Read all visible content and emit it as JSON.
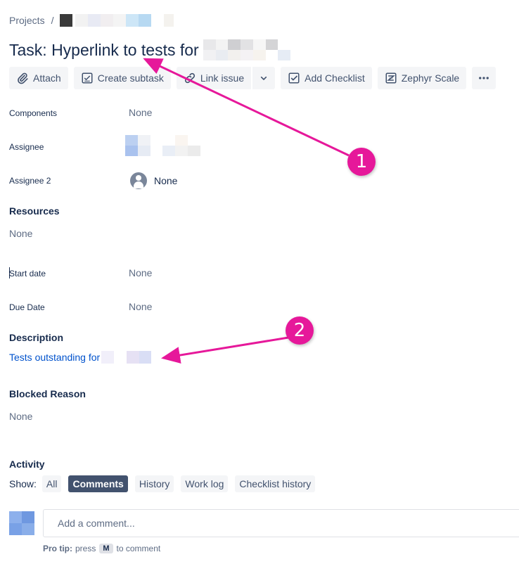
{
  "breadcrumb": {
    "projects": "Projects",
    "separator": "/"
  },
  "issue": {
    "title": "Task: Hyperlink to tests for"
  },
  "toolbar": {
    "attach": "Attach",
    "create_subtask": "Create subtask",
    "link_issue": "Link issue",
    "add_checklist": "Add Checklist",
    "zephyr_scale": "Zephyr Scale"
  },
  "fields": {
    "components": {
      "label": "Components",
      "value": "None"
    },
    "assignee": {
      "label": "Assignee"
    },
    "assignee2": {
      "label": "Assignee 2",
      "value": "None"
    },
    "resources": {
      "label": "Resources",
      "value": "None"
    },
    "start_date": {
      "label": "Start date",
      "value": "None"
    },
    "due_date": {
      "label": "Due Date",
      "value": "None"
    }
  },
  "description": {
    "heading": "Description",
    "link_text": "Tests outstanding for"
  },
  "blocked": {
    "heading": "Blocked Reason",
    "value": "None"
  },
  "activity": {
    "heading": "Activity",
    "show_label": "Show:",
    "filters": [
      "All",
      "Comments",
      "History",
      "Work log",
      "Checklist history"
    ],
    "active_filter": "Comments"
  },
  "comment": {
    "placeholder": "Add a comment...",
    "protip_bold": "Pro tip:",
    "protip_pre": "press",
    "protip_key": "M",
    "protip_post": "to comment"
  },
  "annotations": {
    "callout1": "1",
    "callout2": "2"
  },
  "colors": {
    "annotation": "#e6189a",
    "link": "#0052cc",
    "active_chip": "#42526e"
  },
  "icons": {
    "attach": "paperclip-icon",
    "create_subtask": "subtask-icon",
    "link_issue": "link-icon",
    "dropdown": "chevron-down-icon",
    "add_checklist": "checkbox-icon",
    "zephyr_scale": "zephyr-icon",
    "more": "more-icon",
    "assignee2_avatar": "user-avatar-icon"
  }
}
